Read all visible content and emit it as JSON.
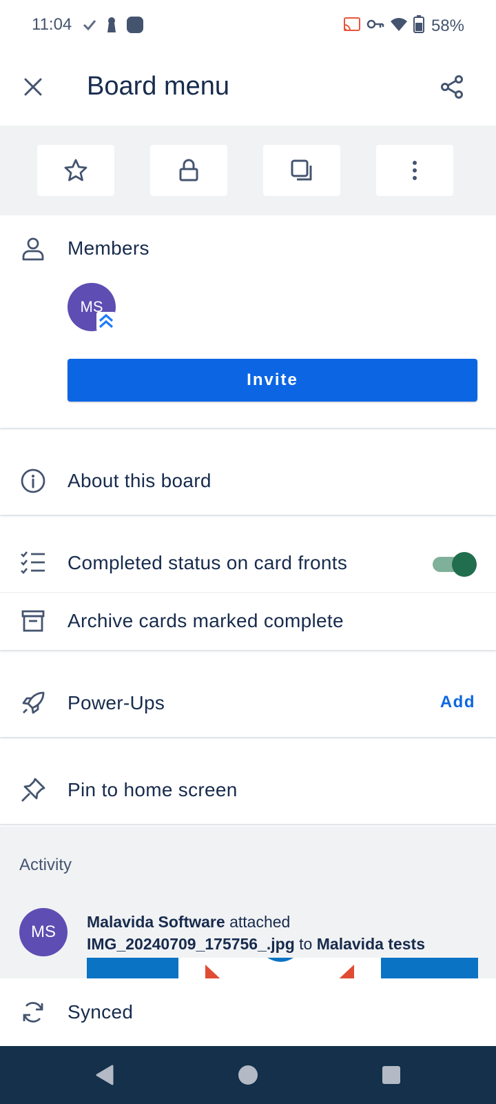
{
  "status_bar": {
    "time": "11:04",
    "battery": "58%"
  },
  "app_bar": {
    "title": "Board menu",
    "close_icon": "close-icon",
    "share_icon": "share-icon"
  },
  "quick_actions": [
    {
      "name": "star",
      "icon": "star-icon"
    },
    {
      "name": "lock",
      "icon": "lock-icon"
    },
    {
      "name": "copy",
      "icon": "copy-icon"
    },
    {
      "name": "more",
      "icon": "more-vertical-icon"
    }
  ],
  "members": {
    "label": "Members",
    "avatar_initials": "MS",
    "invite_label": "Invite"
  },
  "about": {
    "label": "About this board"
  },
  "completion": {
    "completed_status_label": "Completed status on card fronts",
    "completed_status_on": true,
    "archive_label": "Archive cards marked complete"
  },
  "power_ups": {
    "label": "Power-Ups",
    "action_label": "Add"
  },
  "pin": {
    "label": "Pin to home screen"
  },
  "activity": {
    "title": "Activity",
    "item": {
      "avatar_initials": "MS",
      "actor": "Malavida Software",
      "verb": "attached",
      "file": "IMG_20240709_175756_.jpg",
      "preposition": "to",
      "target": "Malavida tests"
    }
  },
  "footer": {
    "synced_label": "Synced"
  },
  "colors": {
    "accent": "#0c66e4",
    "avatar": "#5e4db2",
    "toggle_on": "#216e4e",
    "text": "#172b4d",
    "nav_bar": "#14304a"
  }
}
